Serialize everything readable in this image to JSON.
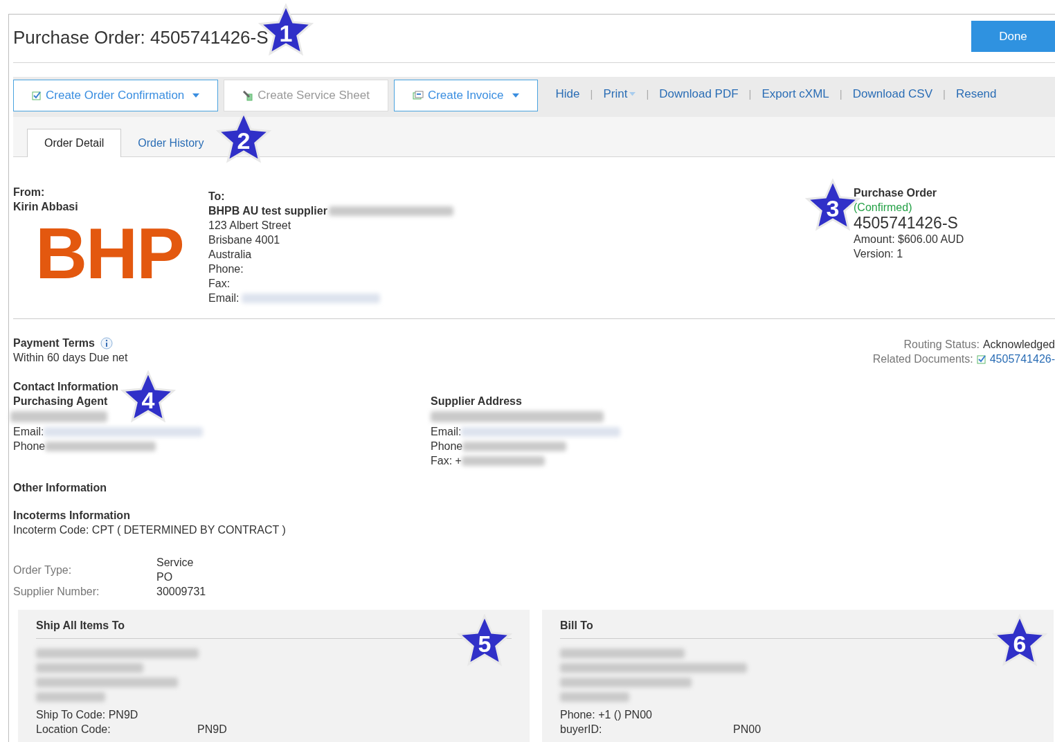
{
  "header": {
    "title": "Purchase Order: 4505741426-S",
    "done_button": "Done"
  },
  "toolbar": {
    "separator": "|",
    "buttons": [
      {
        "label": "Create Order Confirmation",
        "kind": "confirm",
        "disabled": false,
        "dropdown": true
      },
      {
        "label": "Create Service Sheet",
        "kind": "service",
        "disabled": true,
        "dropdown": false
      },
      {
        "label": "Create Invoice",
        "kind": "invoice",
        "disabled": false,
        "dropdown": true
      }
    ],
    "links": [
      {
        "label": "Hide",
        "dropdown": false
      },
      {
        "label": "Print",
        "dropdown": true
      },
      {
        "label": "Download PDF",
        "dropdown": false
      },
      {
        "label": "Export cXML",
        "dropdown": false
      },
      {
        "label": "Download CSV",
        "dropdown": false
      },
      {
        "label": "Resend",
        "dropdown": false
      }
    ]
  },
  "tabs": [
    {
      "label": "Order Detail",
      "selected": true
    },
    {
      "label": "Order History",
      "selected": false
    }
  ],
  "from": {
    "label": "From:",
    "name": "Kirin Abbasi",
    "logo": "BHP"
  },
  "to": {
    "label": "To:",
    "name": "BHPB AU test supplier",
    "lines": [
      "123 Albert Street",
      "Brisbane 4001",
      "Australia"
    ],
    "phone_label": "Phone:",
    "fax_label": "Fax:",
    "email_label": "Email:"
  },
  "po_summary": {
    "heading": "Purchase Order",
    "status": "(Confirmed)",
    "number": "4505741426-S",
    "amount": "Amount: $606.00 AUD",
    "version": "Version: 1"
  },
  "payment_terms": {
    "heading": "Payment Terms",
    "value": "Within 60 days Due net"
  },
  "routing": {
    "status_label": "Routing Status:",
    "status_value": "Acknowledged",
    "related_label": "Related Documents:",
    "related_link": "4505741426-"
  },
  "contact": {
    "heading": "Contact Information",
    "agent_heading": "Purchasing Agent",
    "email_label": "Email:",
    "phone_label": "Phone"
  },
  "supplier_address": {
    "heading": "Supplier Address",
    "email_label": "Email:",
    "phone_label": "Phone",
    "fax_label": "Fax:  +"
  },
  "other_information": "Other Information",
  "incoterms": {
    "heading": "Incoterms Information",
    "code": "Incoterm Code:  CPT ( DETERMINED BY CONTRACT )"
  },
  "order_fields": [
    {
      "label": "Order Type:",
      "values": [
        "Service",
        "PO"
      ]
    },
    {
      "label": "Supplier Number:",
      "values": [
        "30009731"
      ]
    }
  ],
  "ship_to": {
    "heading": "Ship All Items To",
    "rows": [
      {
        "label": "Ship To Code:  PN9D"
      },
      {
        "label": "Location Code:",
        "value": "PN9D"
      }
    ]
  },
  "bill_to": {
    "heading": "Bill To",
    "rows": [
      {
        "label": "Phone:  +1 () PN00"
      },
      {
        "label": "buyerID:",
        "value": "PN00"
      }
    ]
  },
  "callouts": [
    "1",
    "2",
    "3",
    "4",
    "5",
    "6"
  ]
}
